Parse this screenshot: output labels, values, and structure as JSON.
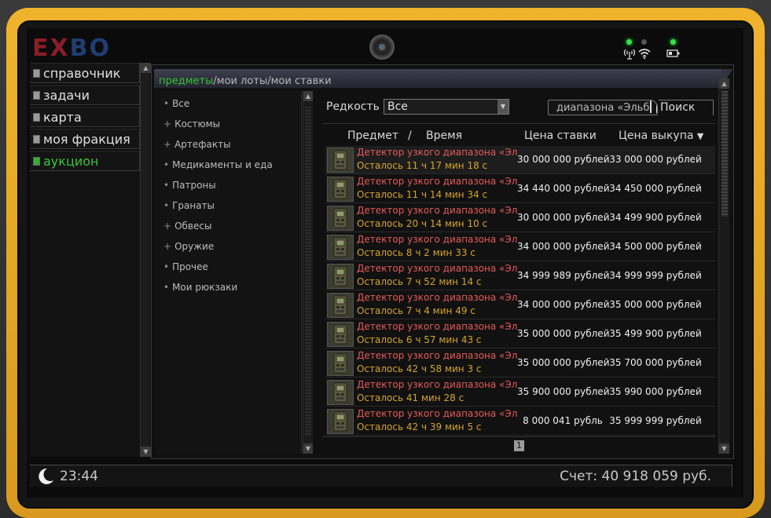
{
  "brand": {
    "logo_left": "EX",
    "logo_right": "BO"
  },
  "nav": {
    "items": [
      {
        "label": "справочник",
        "active": false
      },
      {
        "label": "задачи",
        "active": false
      },
      {
        "label": "карта",
        "active": false
      },
      {
        "label": "моя фракция",
        "active": false
      },
      {
        "label": "аукцион",
        "active": true
      }
    ]
  },
  "tabs": [
    {
      "label": "предметы",
      "active": true
    },
    {
      "label": "мои лоты",
      "active": false
    },
    {
      "label": "мои ставки",
      "active": false
    }
  ],
  "categories": [
    {
      "bullet": "•",
      "label": "Все"
    },
    {
      "bullet": "+",
      "label": "Костюмы"
    },
    {
      "bullet": "+",
      "label": "Артефакты"
    },
    {
      "bullet": "•",
      "label": "Медикаменты и еда"
    },
    {
      "bullet": "•",
      "label": "Патроны"
    },
    {
      "bullet": "•",
      "label": "Гранаты"
    },
    {
      "bullet": "+",
      "label": "Обвесы"
    },
    {
      "bullet": "+",
      "label": "Оружие"
    },
    {
      "bullet": "•",
      "label": "Прочее"
    },
    {
      "bullet": "•",
      "label": "Мои рюкзаки"
    }
  ],
  "filter": {
    "rarity_label": "Редкость",
    "rarity_value": "Все",
    "search_value": "диапазона «Эльб",
    "search_button": "Поиск"
  },
  "table": {
    "headers": {
      "item": "Предмет",
      "sep": "/",
      "time": "Время",
      "bid": "Цена ставки",
      "buyout": "Цена выкупа",
      "sort_arrow": "▼"
    },
    "rows": [
      {
        "name": "Детектор узкого диапазона «Эл..",
        "time": "Осталось 11 ч 17 мин 18 с",
        "bid": "30 000 000 рублей",
        "buyout": "33 000 000 рублей"
      },
      {
        "name": "Детектор узкого диапазона «Эл..",
        "time": "Осталось 11 ч 14 мин 34 с",
        "bid": "34 440 000 рублей",
        "buyout": "34 450 000 рублей"
      },
      {
        "name": "Детектор узкого диапазона «Эл..",
        "time": "Осталось 20 ч 14 мин 10 с",
        "bid": "30 000 000 рублей",
        "buyout": "34 499 900 рублей"
      },
      {
        "name": "Детектор узкого диапазона «Эл..",
        "time": "Осталось 8 ч 2 мин 33 с",
        "bid": "34 000 000 рублей",
        "buyout": "34 500 000 рублей"
      },
      {
        "name": "Детектор узкого диапазона «Эл..",
        "time": "Осталось 7 ч 52 мин 14 с",
        "bid": "34 999 989 рублей",
        "buyout": "34 999 999 рублей"
      },
      {
        "name": "Детектор узкого диапазона «Эл..",
        "time": "Осталось 7 ч 4 мин 49 с",
        "bid": "34 000 000 рублей",
        "buyout": "35 000 000 рублей"
      },
      {
        "name": "Детектор узкого диапазона «Эл..",
        "time": "Осталось 6 ч 57 мин 43 с",
        "bid": "35 000 000 рублей",
        "buyout": "35 499 900 рублей"
      },
      {
        "name": "Детектор узкого диапазона «Эл..",
        "time": "Осталось 42 ч 58 мин 3 с",
        "bid": "35 000 000 рублей",
        "buyout": "35 700 000 рублей"
      },
      {
        "name": "Детектор узкого диапазона «Эл..",
        "time": "Осталось 41 мин 28 с",
        "bid": "35 900 000 рублей",
        "buyout": "35 990 000 рублей"
      },
      {
        "name": "Детектор узкого диапазона «Эл..",
        "time": "Осталось 42 ч 39 мин 5 с",
        "bid": "8 000 041 рубль",
        "buyout": "35 999 999 рублей"
      }
    ],
    "page": "1"
  },
  "status": {
    "clock": "23:44",
    "balance": "Счет: 40 918 059 руб."
  },
  "colors": {
    "accent_green": "#34c234",
    "item_red": "#e55a5a",
    "time_gold": "#d6a52a",
    "frame_yellow": "#f0b32c"
  },
  "icons": {
    "item": "detector-icon",
    "time": "moon-icon",
    "signal": "antenna-icon",
    "wifi": "wifi-icon",
    "battery": "battery-icon"
  }
}
